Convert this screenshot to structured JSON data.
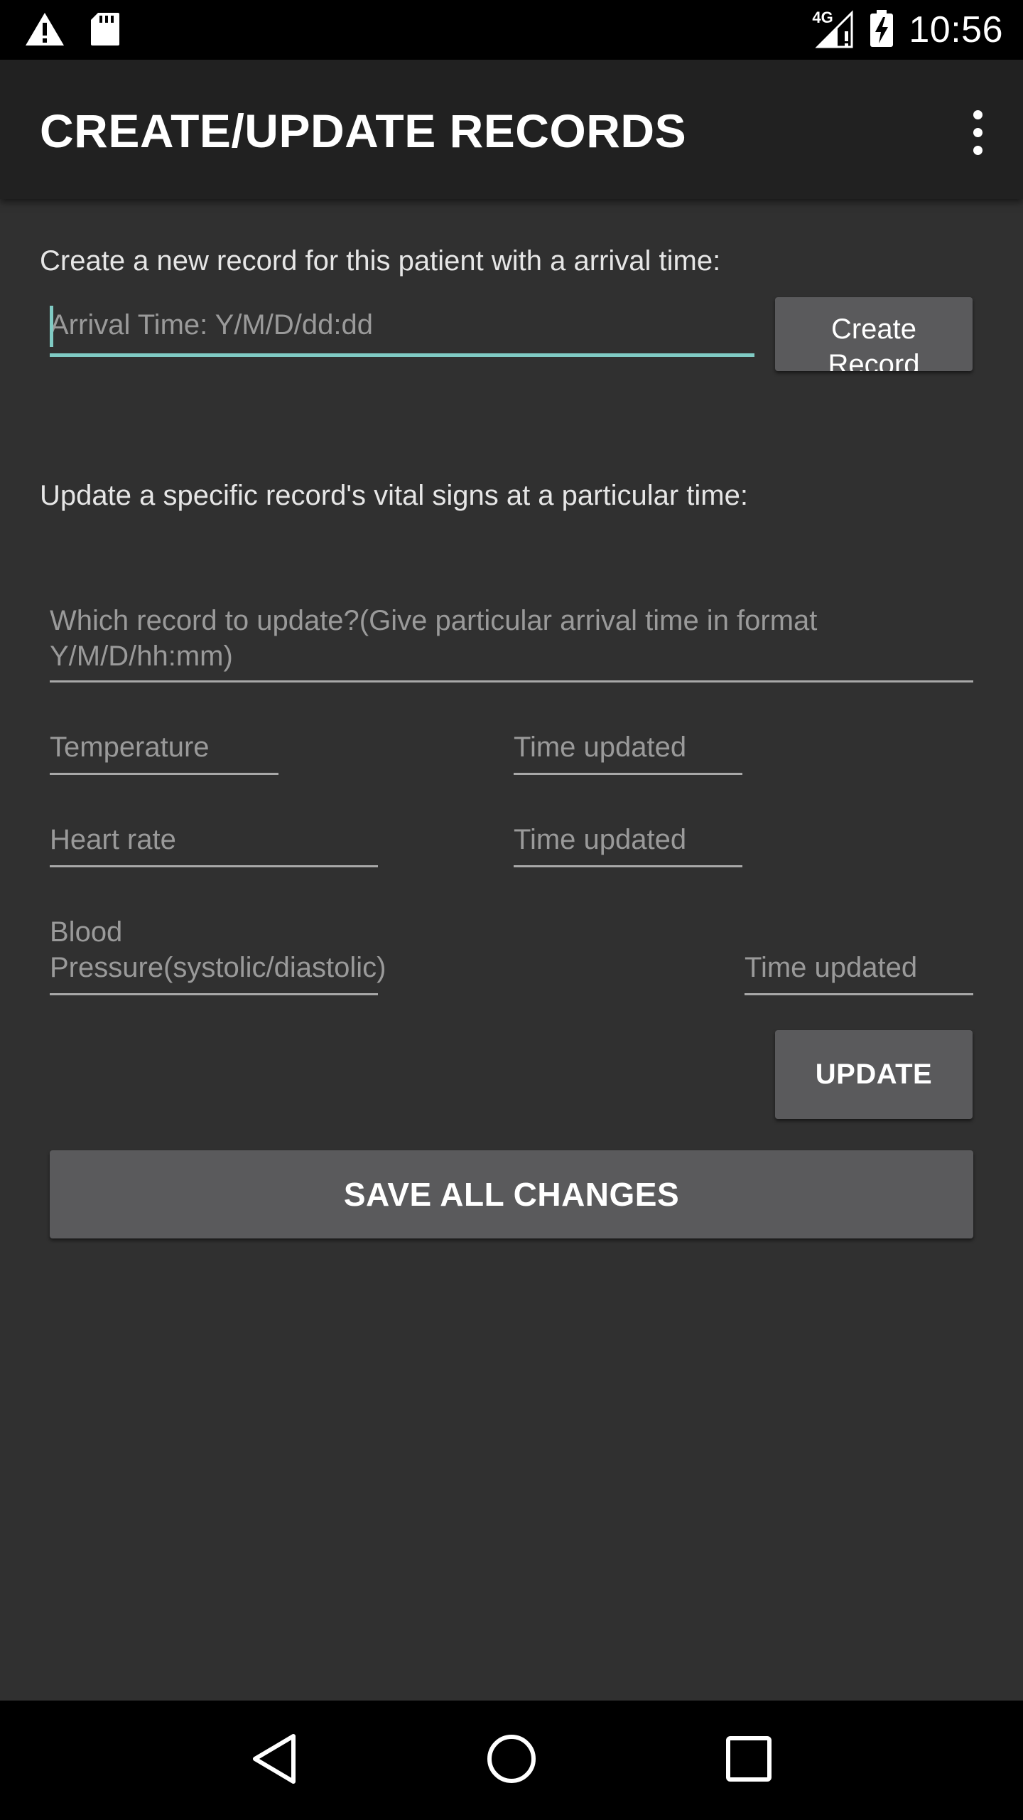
{
  "status_bar": {
    "time": "10:56",
    "network": "4G",
    "icons": [
      "warning-icon",
      "sd-card-icon",
      "signal-icon",
      "battery-charging-icon"
    ]
  },
  "app_bar": {
    "title": "CREATE/UPDATE RECORDS",
    "overflow_icon": "more-vert-icon"
  },
  "create_section": {
    "instruction": "Create a new record for this patient with a arrival time:",
    "arrival_time_placeholder": "Arrival Time: Y/M/D/dd:dd",
    "create_button_label": "Create Record"
  },
  "update_section": {
    "instruction": "Update a specific record's vital signs at a particular time:",
    "record_selector_placeholder": "Which record to update?(Give particular arrival time in format Y/M/D/hh:mm)",
    "temperature_placeholder": "Temperature",
    "temperature_time_placeholder": "Time updated",
    "heart_rate_placeholder": "Heart rate",
    "heart_rate_time_placeholder": "Time updated",
    "blood_pressure_placeholder": "Blood Pressure(systolic/diastolic)",
    "blood_pressure_time_placeholder": "Time updated",
    "update_button_label": "UPDATE"
  },
  "save_button_label": "SAVE ALL CHANGES",
  "colors": {
    "background": "#303030",
    "app_bar": "#212121",
    "accent": "#80cbc4",
    "button": "#5a5a5c"
  }
}
